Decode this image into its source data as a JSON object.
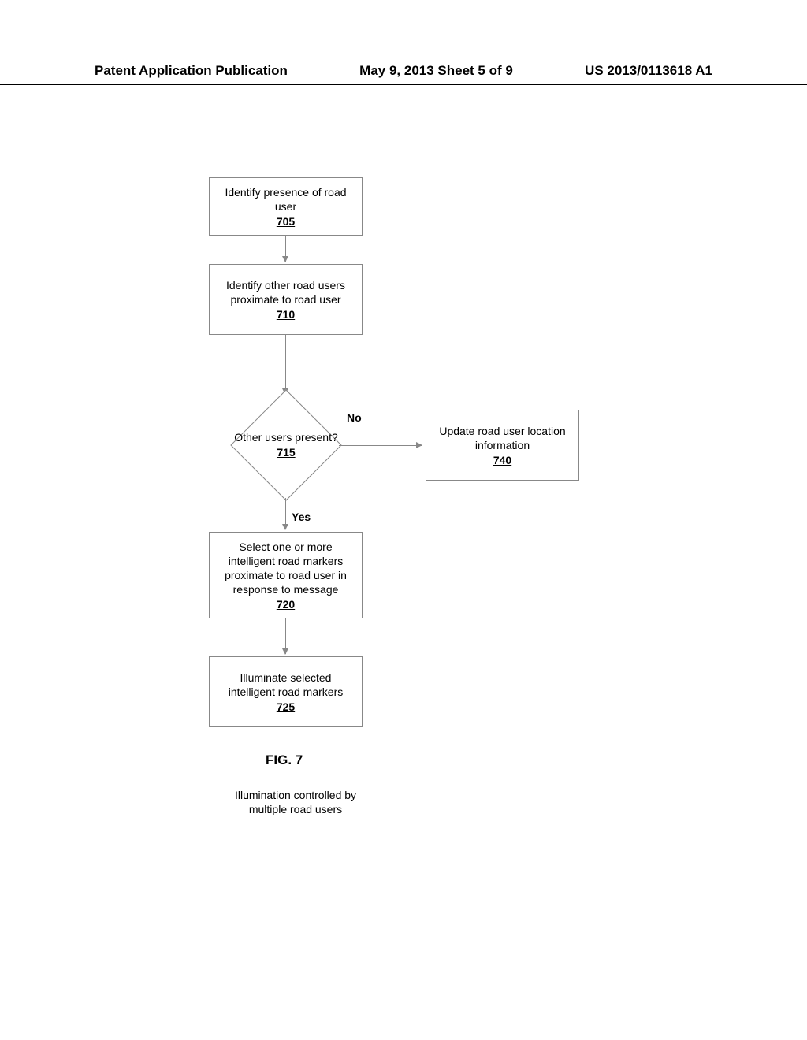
{
  "header": {
    "left": "Patent Application Publication",
    "center": "May 9, 2013  Sheet 5 of 9",
    "right": "US 2013/0113618 A1"
  },
  "boxes": {
    "b705": {
      "text": "Identify presence of road user",
      "num": "705"
    },
    "b710": {
      "text": "Identify other road users proximate to road user",
      "num": "710"
    },
    "b715": {
      "text": "Other users present?",
      "num": "715"
    },
    "b720": {
      "text": "Select one or more intelligent road markers proximate to road user in response to message",
      "num": "720"
    },
    "b725": {
      "text": "Illuminate selected intelligent road markers",
      "num": "725"
    },
    "b740": {
      "text": "Update road user location information",
      "num": "740"
    }
  },
  "labels": {
    "no": "No",
    "yes": "Yes"
  },
  "figure": "FIG. 7",
  "caption": "Illumination controlled by multiple road users"
}
